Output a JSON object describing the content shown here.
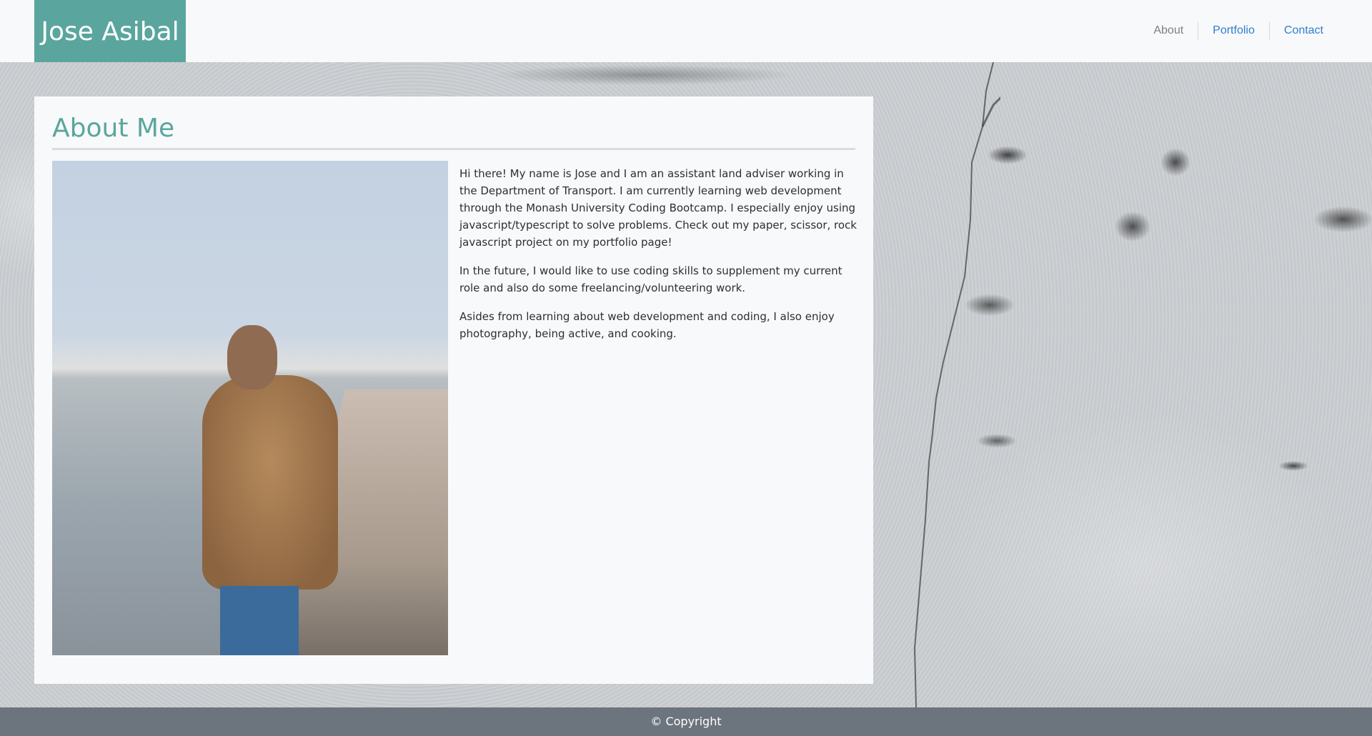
{
  "navbar": {
    "brand": "Jose Asibal",
    "links": [
      {
        "label": "About"
      },
      {
        "label": "Portfolio"
      },
      {
        "label": "Contact"
      }
    ]
  },
  "about": {
    "heading": "About Me",
    "paragraphs": [
      "Hi there! My name is Jose and I am an assistant land adviser working in the Department of Transport. I am currently learning web development through the Monash University Coding Bootcamp. I especially enjoy using javascript/typescript to solve problems. Check out my paper, scissor, rock javascript project on my portfolio page!",
      "In the future, I would like to use coding skills to supplement my current role and also do some freelancing/volunteering work.",
      "Asides from learning about web development and coding, I also enjoy photography, being active, and cooking."
    ]
  },
  "footer": {
    "text": "© Copyright"
  },
  "colors": {
    "accent": "#5aa69e",
    "link": "#2f7ecf",
    "footer_bg": "#6c757d"
  }
}
